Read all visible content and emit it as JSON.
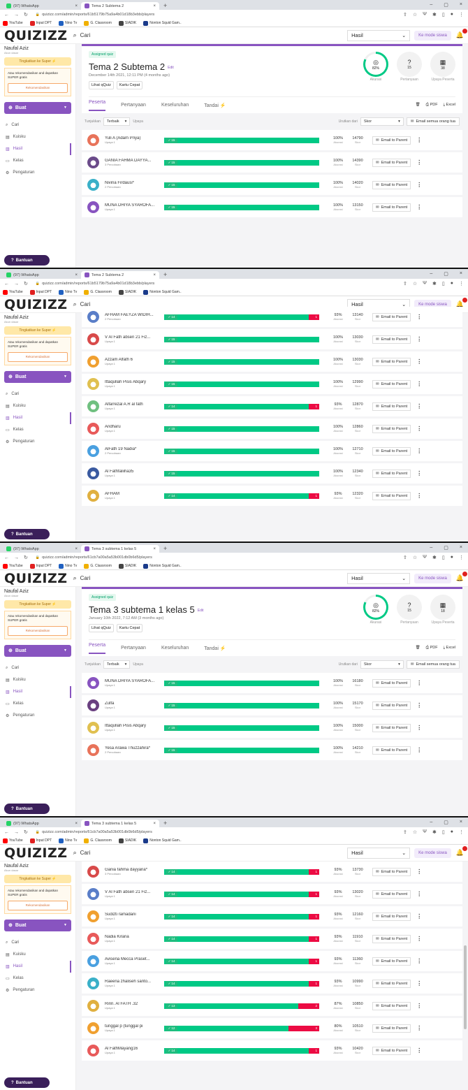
{
  "shots": [
    {
      "tabs": [
        {
          "title": "(97) WhatsApp"
        },
        {
          "title": "Tema 2 Subtema 2"
        }
      ],
      "url": "quizizz.com/admin/reports/61b5179b75a9a4b01d18b3ebb/players",
      "bookmarks": [
        "YouTube",
        "Input DPT",
        "Nino Tv",
        "G. Classroom",
        "SIADIK",
        "Nonton Squid Gam.."
      ],
      "header": {
        "search_placeholder": "Cari",
        "hasil": "Hasil",
        "mode_button": "Ke mode siswa"
      },
      "sidebar": {
        "username": "Naufal Aziz",
        "status": "Akun dasar",
        "upgrade": "Tingkatkan ke Super ⚡",
        "rec_text": "Atau rekomendasikan and dapatkan SUPER gratis",
        "rec_button": "Rekomendasikan",
        "create": "Buat",
        "nav": [
          "Cari",
          "Kuisku",
          "Hasil",
          "Kelas",
          "Pengaturan"
        ],
        "help": "Bantuan"
      },
      "quiz": {
        "badge": "Assigned quiz",
        "title": "Tema 2 Subtema 2",
        "edit": "Edit",
        "date": "December 14th 2021, 12:11 PM (4 months ago)",
        "buttons": [
          "Lihat qQuiz",
          "Kartu Cepat"
        ],
        "stats": [
          {
            "value": "82%",
            "label": "Akurasi"
          },
          {
            "value": "15",
            "label": "Pertanyaan"
          },
          {
            "value": "38",
            "label": "Upaya Peserta"
          }
        ],
        "tabs": [
          "Peserta",
          "Pertanyaan",
          "Keseluruhan",
          "Tandai ⚡"
        ],
        "exports": [
          "PDF",
          "Excel"
        ]
      },
      "filter": {
        "label": "Tunjukkan",
        "value": "Terbaik",
        "sub": "Upaya",
        "sort_label": "Urutkan dari",
        "sort_value": "Skor",
        "email_all": "Email semua orang tua"
      },
      "rows": [
        {
          "name": "Yuli A (Adam Priya)",
          "attempts": "Upaya 1",
          "correct": "15",
          "wrong": "",
          "accuracy": 100,
          "score": "14790",
          "avatar_color": "#e8735a"
        },
        {
          "name": "GANIA FAHMA DAYYA...",
          "attempts": "3 Percobaan",
          "correct": "15",
          "wrong": "",
          "accuracy": 100,
          "score": "14390",
          "avatar_color": "#6b4b8a"
        },
        {
          "name": "Nivina Firdausi*",
          "attempts": "2 Percobaan",
          "correct": "15",
          "wrong": "",
          "accuracy": 100,
          "score": "14020",
          "avatar_color": "#3ab0c8"
        },
        {
          "name": "MUNA DHIYA SYAROFA...",
          "attempts": "Upaya 1",
          "correct": "15",
          "wrong": "",
          "accuracy": 100,
          "score": "13150",
          "avatar_color": "#8854c0"
        }
      ]
    },
    {
      "tabs": [
        {
          "title": "(97) WhatsApp"
        },
        {
          "title": "Tema 2 Subtema 2"
        }
      ],
      "url": "quizizz.com/admin/reports/61b5179b75a9a4b01d18b3ebb/players",
      "bookmarks": [
        "YouTube",
        "Input DPT",
        "Nino Tv",
        "G. Classroom",
        "SIADIK",
        "Nonton Squid Gam.."
      ],
      "header": {
        "search_placeholder": "Cari",
        "hasil": "Hasil",
        "mode_button": "Ke mode siswa"
      },
      "sidebar": {
        "username": "Naufal Aziz",
        "status": "Akun dasar",
        "upgrade": "Tingkatkan ke Super ⚡",
        "rec_text": "Atau rekomendasikan and dapatkan SUPER gratis",
        "rec_button": "Rekomendasikan",
        "create": "Buat",
        "nav": [
          "Cari",
          "Kuisku",
          "Hasil",
          "Kelas",
          "Pengaturan"
        ],
        "help": "Bantuan"
      },
      "rows": [
        {
          "name": "AFHAM FAEYZA WIDIH...",
          "attempts": "2 Percobaan",
          "correct": "14",
          "wrong": "1",
          "accuracy": 93,
          "score": "13140",
          "avatar_color": "#5a7ec8"
        },
        {
          "name": "V Al Fath absen 21 Fiz...",
          "attempts": "Upaya 1",
          "correct": "15",
          "wrong": "",
          "accuracy": 100,
          "score": "13030",
          "avatar_color": "#d84a4a"
        },
        {
          "name": "Azzam Alfath 6",
          "attempts": "Upaya 1",
          "correct": "15",
          "wrong": "",
          "accuracy": 100,
          "score": "13030",
          "avatar_color": "#f0a030"
        },
        {
          "name": "Ittaqullah Pisis Abqary",
          "attempts": "Upaya 1",
          "correct": "15",
          "wrong": "",
          "accuracy": 100,
          "score": "12990",
          "avatar_color": "#e0c050"
        },
        {
          "name": "Alfarrezal A.R al fath",
          "attempts": "Upaya 1",
          "correct": "14",
          "wrong": "1",
          "accuracy": 93,
          "score": "12870",
          "avatar_color": "#70c080"
        },
        {
          "name": "Andharu",
          "attempts": "Upaya 1",
          "correct": "15",
          "wrong": "",
          "accuracy": 100,
          "score": "12860",
          "avatar_color": "#e85a5a"
        },
        {
          "name": "AlFath 19 Nadia*",
          "attempts": "2 Percobaan",
          "correct": "15",
          "wrong": "",
          "accuracy": 100,
          "score": "12710",
          "avatar_color": "#4aa0e0"
        },
        {
          "name": "Al Fathfaliiha35",
          "attempts": "Upaya 1",
          "correct": "15",
          "wrong": "",
          "accuracy": 100,
          "score": "12340",
          "avatar_color": "#3a5aa0"
        },
        {
          "name": "AFHAM",
          "attempts": "Upaya 1",
          "correct": "14",
          "wrong": "1",
          "accuracy": 93,
          "score": "12320",
          "avatar_color": "#e0b040"
        }
      ]
    },
    {
      "tabs": [
        {
          "title": "(97) WhatsApp"
        },
        {
          "title": "Tema 3 subtema 1 kelas 5"
        }
      ],
      "url": "quizizz.com/admin/reports/61cb7a00a5a53b001db0b6d5/players",
      "bookmarks": [
        "YouTube",
        "Input DPT",
        "Nino Tv",
        "G. Classroom",
        "SIADIK",
        "Nonton Squid Gam.."
      ],
      "header": {
        "search_placeholder": "Cari",
        "hasil": "Hasil",
        "mode_button": "Ke mode siswa"
      },
      "sidebar": {
        "username": "Naufal Aziz",
        "status": "Akun dasar",
        "upgrade": "Tingkatkan ke Super ⚡",
        "rec_text": "Atau rekomendasikan and dapatkan SUPER gratis",
        "rec_button": "Rekomendasikan",
        "create": "Buat",
        "nav": [
          "Cari",
          "Kuisku",
          "Hasil",
          "Kelas",
          "Pengaturan"
        ],
        "help": "Bantuan"
      },
      "quiz": {
        "badge": "Assigned quiz",
        "title": "Tema 3 subtema 1 kelas 5",
        "edit": "Edit",
        "date": "January 10th 2022, 7:12 AM (3 months ago)",
        "buttons": [
          "Lihat qQuiz",
          "Kartu Cepat"
        ],
        "stats": [
          {
            "value": "82%",
            "label": "Akurasi"
          },
          {
            "value": "15",
            "label": "Pertanyaan"
          },
          {
            "value": "18",
            "label": "Upaya Peserta"
          }
        ],
        "tabs": [
          "Peserta",
          "Pertanyaan",
          "Keseluruhan",
          "Tandai ⚡"
        ],
        "exports": [
          "PDF",
          "Excel"
        ]
      },
      "filter": {
        "label": "Tunjukkan",
        "value": "Terbaik",
        "sub": "Upaya",
        "sort_label": "Urutkan dari",
        "sort_value": "Skor",
        "email_all": "Email semua orang tua"
      },
      "rows": [
        {
          "name": "MUNA DHIYA SYAROFA...",
          "attempts": "Upaya 1",
          "correct": "15",
          "wrong": "",
          "accuracy": 100,
          "score": "16180",
          "avatar_color": "#8854c0"
        },
        {
          "name": "Zulfa",
          "attempts": "Upaya 1",
          "correct": "15",
          "wrong": "",
          "accuracy": 100,
          "score": "15170",
          "avatar_color": "#6a4080"
        },
        {
          "name": "Ittaqullah Pisis Abqary",
          "attempts": "Upaya 1",
          "correct": "15",
          "wrong": "",
          "accuracy": 100,
          "score": "15000",
          "avatar_color": "#e0c050"
        },
        {
          "name": "Yesa Arawa Thuzzahira*",
          "attempts": "2 Percobaan",
          "correct": "15",
          "wrong": "",
          "accuracy": 100,
          "score": "14210",
          "avatar_color": "#e8735a"
        }
      ]
    },
    {
      "tabs": [
        {
          "title": "(97) WhatsApp"
        },
        {
          "title": "Tema 3 subtema 1 kelas 5"
        }
      ],
      "url": "quizizz.com/admin/reports/61cb7a00a5a53b001db0b6d5/players",
      "bookmarks": [
        "YouTube",
        "Input DPT",
        "Nino Tv",
        "G. Classroom",
        "SIADIK",
        "Nonton Squid Gam.."
      ],
      "header": {
        "search_placeholder": "Cari",
        "hasil": "Hasil",
        "mode_button": "Ke mode siswa"
      },
      "sidebar": {
        "username": "Naufal Aziz",
        "status": "Akun dasar",
        "upgrade": "Tingkatkan ke Super ⚡",
        "rec_text": "Atau rekomendasikan and dapatkan SUPER gratis",
        "rec_button": "Rekomendasikan",
        "create": "Buat",
        "nav": [
          "Cari",
          "Kuisku",
          "Hasil",
          "Kelas",
          "Pengaturan"
        ],
        "help": "Bantuan"
      },
      "rows": [
        {
          "name": "Gania fahma dayyana*",
          "attempts": "3 Percobaan",
          "correct": "14",
          "wrong": "1",
          "accuracy": 93,
          "score": "13730",
          "avatar_color": "#d84a4a"
        },
        {
          "name": "V Al Fath absen 21 Fiz...",
          "attempts": "Upaya 1",
          "correct": "14",
          "wrong": "1",
          "accuracy": 93,
          "score": "13020",
          "avatar_color": "#5a7ec8"
        },
        {
          "name": "Sudizti ramadani",
          "attempts": "Upaya 1",
          "correct": "14",
          "wrong": "1",
          "accuracy": 93,
          "score": "12160",
          "avatar_color": "#f0a030"
        },
        {
          "name": "Nadia Kirana",
          "attempts": "Upaya 1",
          "correct": "14",
          "wrong": "1",
          "accuracy": 93,
          "score": "11910",
          "avatar_color": "#e85a5a"
        },
        {
          "name": "Avisena Mecca Praset...",
          "attempts": "Upaya 1",
          "correct": "14",
          "wrong": "1",
          "accuracy": 93,
          "score": "11360",
          "avatar_color": "#4aa0e0"
        },
        {
          "name": "Raeena zhaliseh santo...",
          "attempts": "Upaya 1",
          "correct": "14",
          "wrong": "1",
          "accuracy": 93,
          "score": "10990",
          "avatar_color": "#3ab0c8"
        },
        {
          "name": "Ririn. Al FATH .32",
          "attempts": "Upaya 1",
          "correct": "13",
          "wrong": "2",
          "accuracy": 87,
          "score": "10850",
          "avatar_color": "#e0b040"
        },
        {
          "name": "tunggal p (tunggal pi",
          "attempts": "Upaya 1",
          "correct": "12",
          "wrong": "3",
          "accuracy": 80,
          "score": "10510",
          "avatar_color": "#f0a030"
        },
        {
          "name": "Al FathMayang16",
          "attempts": "Upaya 1",
          "correct": "14",
          "wrong": "1",
          "accuracy": 93,
          "score": "10420",
          "avatar_color": "#e85a5a"
        }
      ]
    }
  ],
  "common": {
    "accuracy_label": "Akurasi",
    "score_label": "Skor",
    "email_parent": "Email to Parent",
    "logo": "QUIZIZZ"
  }
}
